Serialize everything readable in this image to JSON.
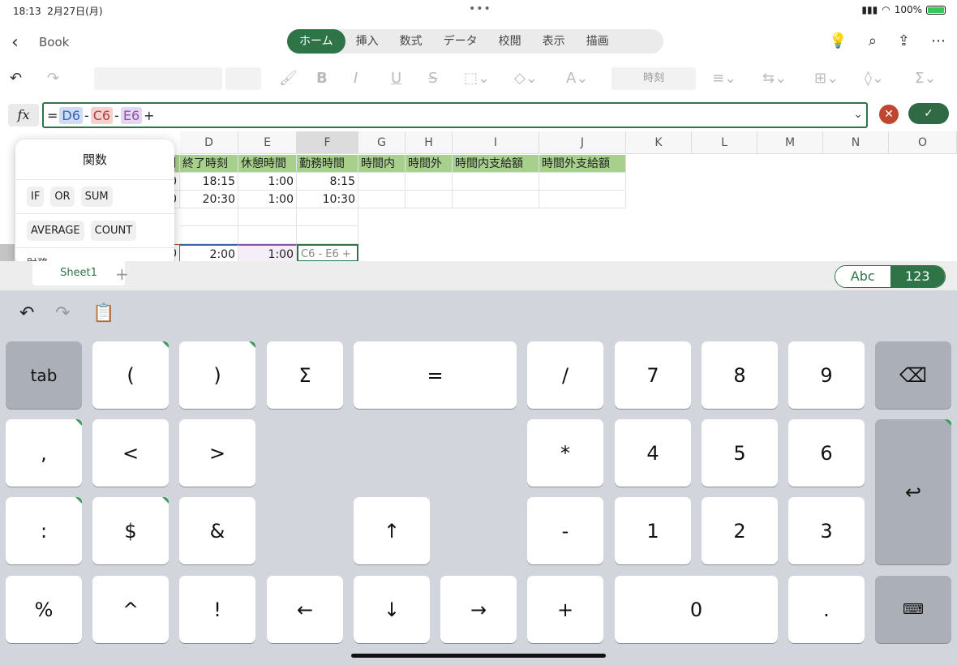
{
  "status": {
    "time": "18:13",
    "date": "2月27日(月)",
    "battery": "100%"
  },
  "appbar": {
    "doc_name": "Book",
    "tabs": [
      "ホーム",
      "挿入",
      "数式",
      "データ",
      "校閲",
      "表示",
      "描画"
    ]
  },
  "ribbon": {
    "number_format": "時刻"
  },
  "formula": {
    "fx": "fx",
    "eq": "=",
    "ref1": "D6",
    "op1": "-",
    "ref2": "C6",
    "op2": "-",
    "ref3": "E6",
    "op3": "+"
  },
  "grid": {
    "columns": [
      "D",
      "E",
      "F",
      "G",
      "H",
      "I",
      "J",
      "K",
      "L",
      "M",
      "N",
      "O"
    ],
    "header_row": [
      "終了時刻",
      "休憩時間",
      "勤務時間",
      "時間内",
      "時間外",
      "時間内支給額",
      "時間外支給額"
    ],
    "row1": {
      "c_tail": "0",
      "d": "18:15",
      "e": "1:00",
      "f": "8:15"
    },
    "row2": {
      "c_tail": "0",
      "d": "20:30",
      "e": "1:00",
      "f": "10:30"
    },
    "row5": {
      "c_tail": "0",
      "d": "2:00",
      "e": "1:00",
      "f": "C6 - E6 +"
    },
    "partial_left_header": "刻"
  },
  "function_popup": {
    "title": "関数",
    "row1": [
      "IF",
      "OR",
      "SUM"
    ],
    "row2": [
      "AVERAGE",
      "COUNT"
    ],
    "more": "財務"
  },
  "sheets": {
    "tab": "Sheet1",
    "add": "+",
    "mode_abc": "Abc",
    "mode_123": "123"
  },
  "keyboard": {
    "row1": [
      "tab",
      "(",
      ")",
      "Σ",
      "=",
      "/",
      "7",
      "8",
      "9"
    ],
    "row2": [
      ",",
      "<",
      ">",
      "*",
      "4",
      "5",
      "6"
    ],
    "row3": [
      ":",
      "$",
      "&",
      "↑",
      "-",
      "1",
      "2",
      "3"
    ],
    "row4": [
      "%",
      "^",
      "!",
      "←",
      "↓",
      "→",
      "+",
      "0",
      "."
    ]
  }
}
